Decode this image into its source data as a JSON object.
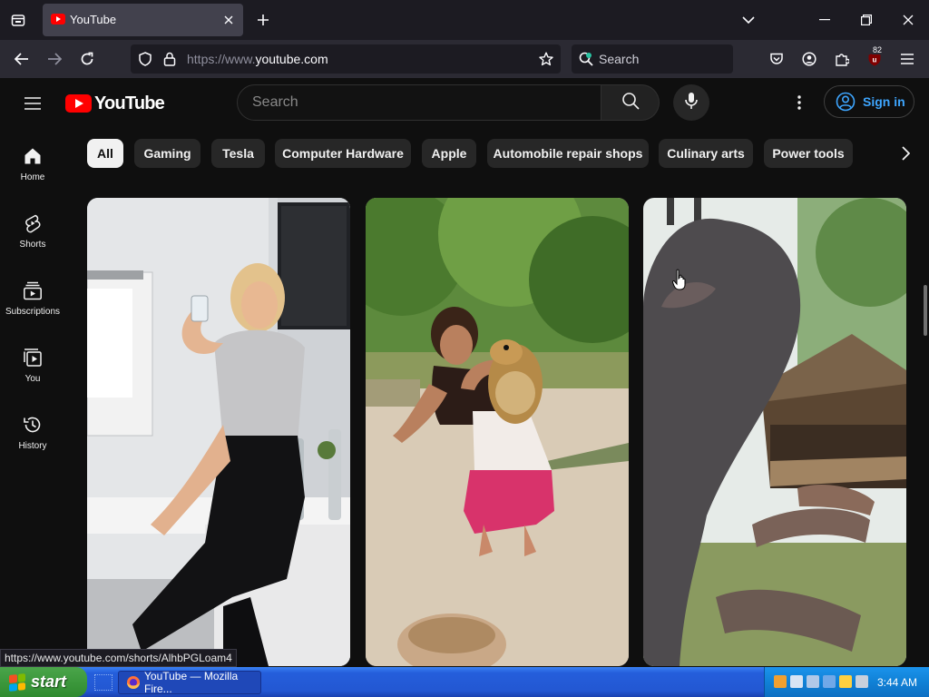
{
  "browser": {
    "tab": {
      "title": "YouTube"
    },
    "url": {
      "prefix": "https://www.",
      "domain": "youtube.com"
    },
    "search_placeholder": "Search",
    "extension_badge": "82",
    "status_link": "https://www.youtube.com/shorts/AlhbPGLoam4"
  },
  "youtube": {
    "logo_text": "YouTube",
    "search_placeholder": "Search",
    "sign_in_label": "Sign in",
    "guide": [
      {
        "label": "Home",
        "icon": "home-icon"
      },
      {
        "label": "Shorts",
        "icon": "shorts-icon"
      },
      {
        "label": "Subscriptions",
        "icon": "subscriptions-icon"
      },
      {
        "label": "You",
        "icon": "you-icon"
      },
      {
        "label": "History",
        "icon": "history-icon"
      }
    ],
    "chips": [
      {
        "label": "All",
        "active": true
      },
      {
        "label": "Gaming"
      },
      {
        "label": "Tesla"
      },
      {
        "label": "Computer Hardware"
      },
      {
        "label": "Apple"
      },
      {
        "label": "Automobile repair shops"
      },
      {
        "label": "Culinary arts"
      },
      {
        "label": "Power tools"
      }
    ],
    "shorts": [
      {
        "name": "short-woman-drinking"
      },
      {
        "name": "short-girl-with-hamster"
      },
      {
        "name": "short-giant-snake"
      }
    ]
  },
  "taskbar": {
    "start_label": "start",
    "task_label": "YouTube — Mozilla Fire...",
    "clock": "3:44 AM"
  },
  "colors": {
    "yt_red": "#ff0000",
    "link_blue": "#3ea6ff",
    "xp_blue": "#245edb",
    "xp_green": "#3c983c"
  }
}
